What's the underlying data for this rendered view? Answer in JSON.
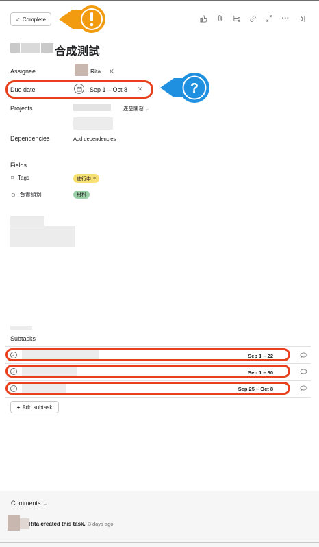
{
  "header": {
    "complete_label": "Complete",
    "complete_check": "✓",
    "toolbar_icons": [
      "thumbs-up-icon",
      "paperclip-icon",
      "subtask-icon",
      "link-icon",
      "expand-icon",
      "more-icon",
      "close-pane-icon"
    ],
    "more_glyph": "···",
    "close_glyph": "→|"
  },
  "task": {
    "title_suffix": "合成測試"
  },
  "fields": {
    "assignee_label": "Assignee",
    "assignee_name": "Rita",
    "remove_glyph": "✕",
    "due_label": "Due date",
    "due_value": "Sep 1 – Oct 8",
    "projects_label": "Projects",
    "project_section": "產品開發",
    "dependencies_label": "Dependencies",
    "add_dependencies": "Add dependencies",
    "fields_label": "Fields",
    "tags_label": "Tags",
    "tag_value": "進行中",
    "tag_remove": "×",
    "group_label": "負責組別",
    "group_value": "材料"
  },
  "subtasks": {
    "heading": "Subtasks",
    "items": [
      {
        "date": "Sep 1 – 22"
      },
      {
        "date": "Sep 1 – 30"
      },
      {
        "date": "Sep 25 – Oct 8"
      }
    ],
    "add_label": "Add subtask",
    "add_plus": "+"
  },
  "comments": {
    "toggle_label": "Comments",
    "activity_actor": "Rita",
    "activity_text": " created this task.",
    "activity_time": "3 days ago"
  },
  "colors": {
    "highlight_red": "#e8401c",
    "warn_orange": "#f39b10",
    "help_blue": "#1f8fe0",
    "tag_yellow": "#f8df72",
    "group_green": "#9ad1a8"
  }
}
